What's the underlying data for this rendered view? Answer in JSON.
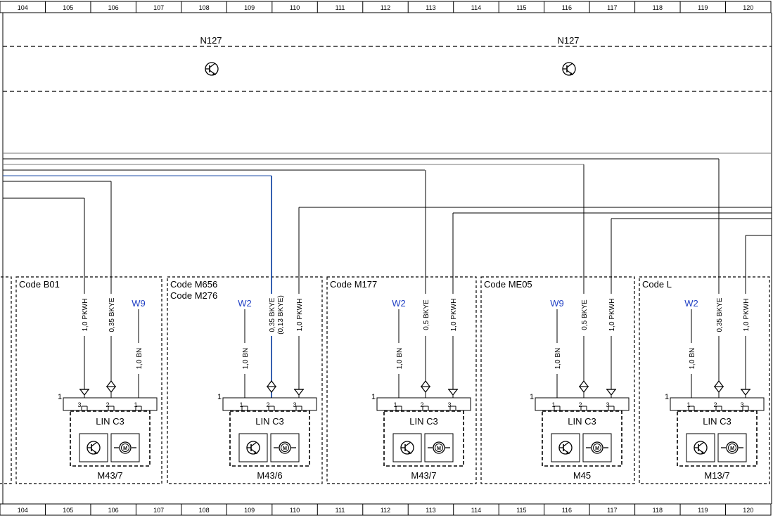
{
  "ruler": {
    "columns": [
      "104",
      "105",
      "106",
      "107",
      "108",
      "109",
      "110",
      "111",
      "112",
      "113",
      "114",
      "115",
      "116",
      "117",
      "118",
      "119",
      "120"
    ]
  },
  "control_unit": {
    "left_label": "N127",
    "right_label": "N127",
    "symbol_left": "transistor-icon",
    "symbol_right": "transistor-icon"
  },
  "modules": [
    {
      "code_lines": [
        "Code B01"
      ],
      "wires": [
        {
          "label": "1,0 PKWH",
          "pin": "3",
          "pin_code": "87C"
        },
        {
          "label": "0,35 BKYE",
          "pin": "2",
          "pin_code": ""
        },
        {
          "label": "1,0 BN",
          "pin": "1",
          "pin_code": "31",
          "ground": "W9"
        }
      ],
      "connector_number": "1",
      "bus_label": "LIN C3",
      "component": "M43/7"
    },
    {
      "code_lines": [
        "Code M656",
        "Code M276"
      ],
      "wires": [
        {
          "label": "1,0 BN",
          "pin": "1",
          "pin_code": "31",
          "ground": "W2"
        },
        {
          "label": "0,35 BKYE",
          "label2": "(0,13 BKYE)",
          "pin": "2",
          "pin_code": ""
        },
        {
          "label": "1,0 PKWH",
          "pin": "3",
          "pin_code": "87C"
        }
      ],
      "connector_number": "1",
      "bus_label": "LIN C3",
      "component": "M43/6"
    },
    {
      "code_lines": [
        "Code M177"
      ],
      "wires": [
        {
          "label": "1,0 BN",
          "pin": "1",
          "pin_code": "31",
          "ground": "W2"
        },
        {
          "label": "0,5 BKYE",
          "pin": "2",
          "pin_code": ""
        },
        {
          "label": "1,0 PKWH",
          "pin": "3",
          "pin_code": "87C"
        }
      ],
      "connector_number": "1",
      "bus_label": "LIN C3",
      "component": "M43/7"
    },
    {
      "code_lines": [
        "Code ME05"
      ],
      "wires": [
        {
          "label": "1,0 BN",
          "pin": "1",
          "pin_code": "31",
          "ground": "W9"
        },
        {
          "label": "0,5 BKYE",
          "pin": "2",
          "pin_code": ""
        },
        {
          "label": "1,0 PKWH",
          "pin": "3",
          "pin_code": "87C"
        }
      ],
      "connector_number": "1",
      "bus_label": "LIN C3",
      "component": "M45"
    },
    {
      "code_lines": [
        "Code L"
      ],
      "wires": [
        {
          "label": "1,0 BN",
          "pin": "1",
          "pin_code": "31",
          "ground": "W2"
        },
        {
          "label": "0,35 BKYE",
          "pin": "2",
          "pin_code": ""
        },
        {
          "label": "1,0 PKWH",
          "pin": "3",
          "pin_code": "87C"
        }
      ],
      "connector_number": "1",
      "bus_label": "LIN C3",
      "component": "M13/7"
    }
  ],
  "colors": {
    "line": "#000000",
    "blue_wire": "#1f4fa8",
    "gray_line": "#808080"
  },
  "icons": [
    "transistor-icon",
    "motor-icon"
  ]
}
